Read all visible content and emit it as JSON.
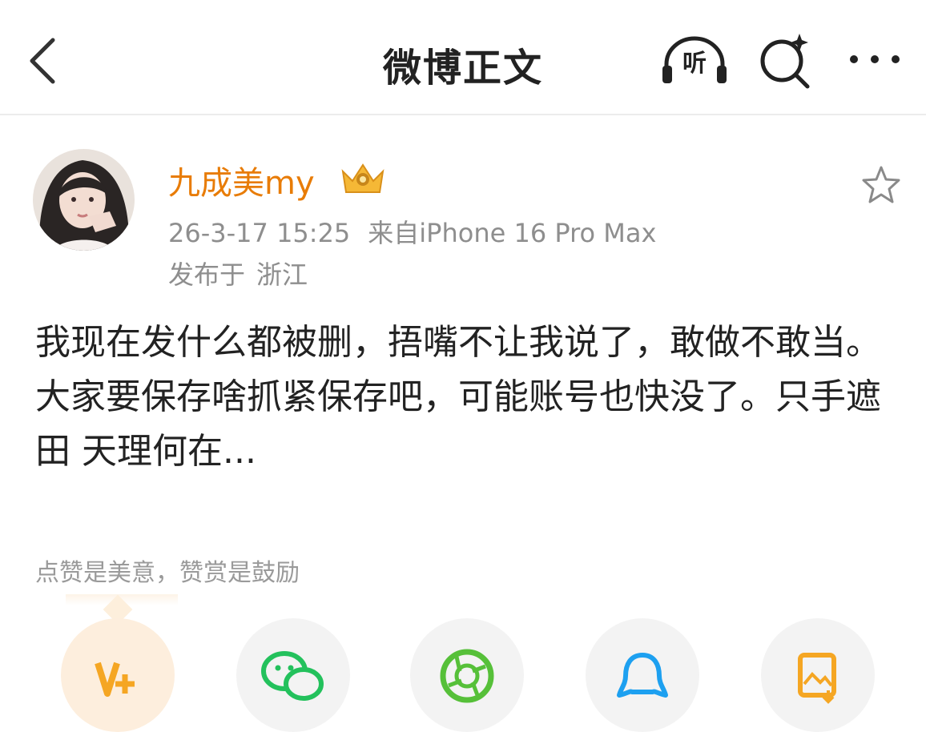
{
  "header": {
    "title": "微博正文",
    "listen_label": "听"
  },
  "post": {
    "author": {
      "name": "九成美my",
      "badge_icon": "crown-icon"
    },
    "timestamp": "26-3-17 15:25",
    "source": "来自iPhone 16 Pro Max",
    "location_prefix": "发布于",
    "location": "浙江",
    "content": "我现在发什么都被删，捂嘴不让我说了，敢做不敢当。大家要保存啥抓紧保存吧，可能账号也快没了。只手遮田 天理何在..."
  },
  "reward": {
    "tip_text": "点赞是美意，赞赏是鼓励"
  },
  "share": {
    "items": [
      "vplus-icon",
      "wechat-icon",
      "moments-icon",
      "qq-icon",
      "image-icon"
    ]
  },
  "colors": {
    "username": "#e87c07",
    "meta_text": "#8e8e8e",
    "wechat": "#23c15c",
    "moments": "#56c039",
    "qq": "#1da0f0",
    "accent_orange": "#f5a623"
  }
}
